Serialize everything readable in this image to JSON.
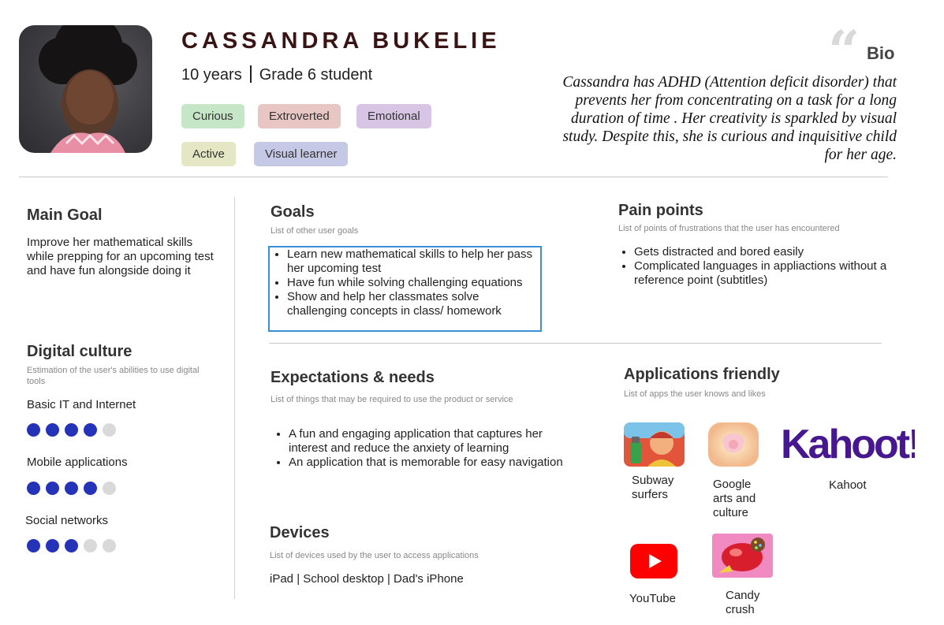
{
  "profile": {
    "name": "CASSANDRA BUKELIE",
    "age": "10 years",
    "grade": "Grade 6 student",
    "tags": [
      {
        "label": "Curious",
        "color": "#c6e6c8"
      },
      {
        "label": "Extroverted",
        "color": "#e8c6c3"
      },
      {
        "label": "Emotional",
        "color": "#d8c5e6"
      },
      {
        "label": "Active",
        "color": "#e5e7c4"
      },
      {
        "label": "Visual learner",
        "color": "#c5c9e6"
      }
    ]
  },
  "bio": {
    "title": "Bio",
    "text": "Cassandra has ADHD (Attention deficit disorder) that prevents her from concentrating on a task for a long duration of time . Her creativity is sparkled by visual study. Despite this, she is  curious and inquisitive child for her age."
  },
  "main_goal": {
    "title": "Main Goal",
    "text": "Improve her mathematical skills while prepping for an upcoming test and have fun alongside doing it"
  },
  "digital_culture": {
    "title": "Digital culture",
    "caption": "Estimation of the user's abilities to use digital tools",
    "skills": [
      {
        "label": "Basic IT and Internet",
        "level": 4,
        "max": 5
      },
      {
        "label": "Mobile applications",
        "level": 4,
        "max": 5
      },
      {
        "label": "Social networks",
        "level": 3,
        "max": 5
      }
    ],
    "filled_color": "#2433b8",
    "empty_color": "#d9d9d9"
  },
  "goals": {
    "title": "Goals",
    "caption": "List of other user goals",
    "items": [
      "Learn new mathematical skills to help her pass her upcoming test",
      "Have fun while solving challenging equations",
      "Show and help her classmates solve challenging concepts in class/ homework"
    ]
  },
  "pain_points": {
    "title": "Pain points",
    "caption": "List of points of frustrations that the user has encountered",
    "items": [
      "Gets distracted and bored easily",
      "Complicated languages in appliactions without a reference point (subtitles)"
    ]
  },
  "expectations": {
    "title": "Expectations & needs",
    "caption": "List of things that may be required to use the product or service",
    "items": [
      "A fun and engaging application that captures her interest and reduce the anxiety of learning",
      "An application that is memorable for easy navigation"
    ]
  },
  "devices": {
    "title": "Devices",
    "caption": "List of devices used by the user to access applications",
    "list": "iPad | School desktop | Dad's iPhone"
  },
  "apps": {
    "title": "Applications  friendly",
    "caption": "List of apps the user knows and likes",
    "kahoot_logo_text": "Kahoot!",
    "items": [
      {
        "name": "Subway surfers",
        "icon": "subway-surfers-icon"
      },
      {
        "name": "Google arts and culture",
        "icon": "google-arts-culture-icon"
      },
      {
        "name": "Kahoot",
        "icon": "kahoot-logo"
      },
      {
        "name": "YouTube",
        "icon": "youtube-icon"
      },
      {
        "name": "Candy crush",
        "icon": "candy-crush-icon"
      }
    ]
  }
}
